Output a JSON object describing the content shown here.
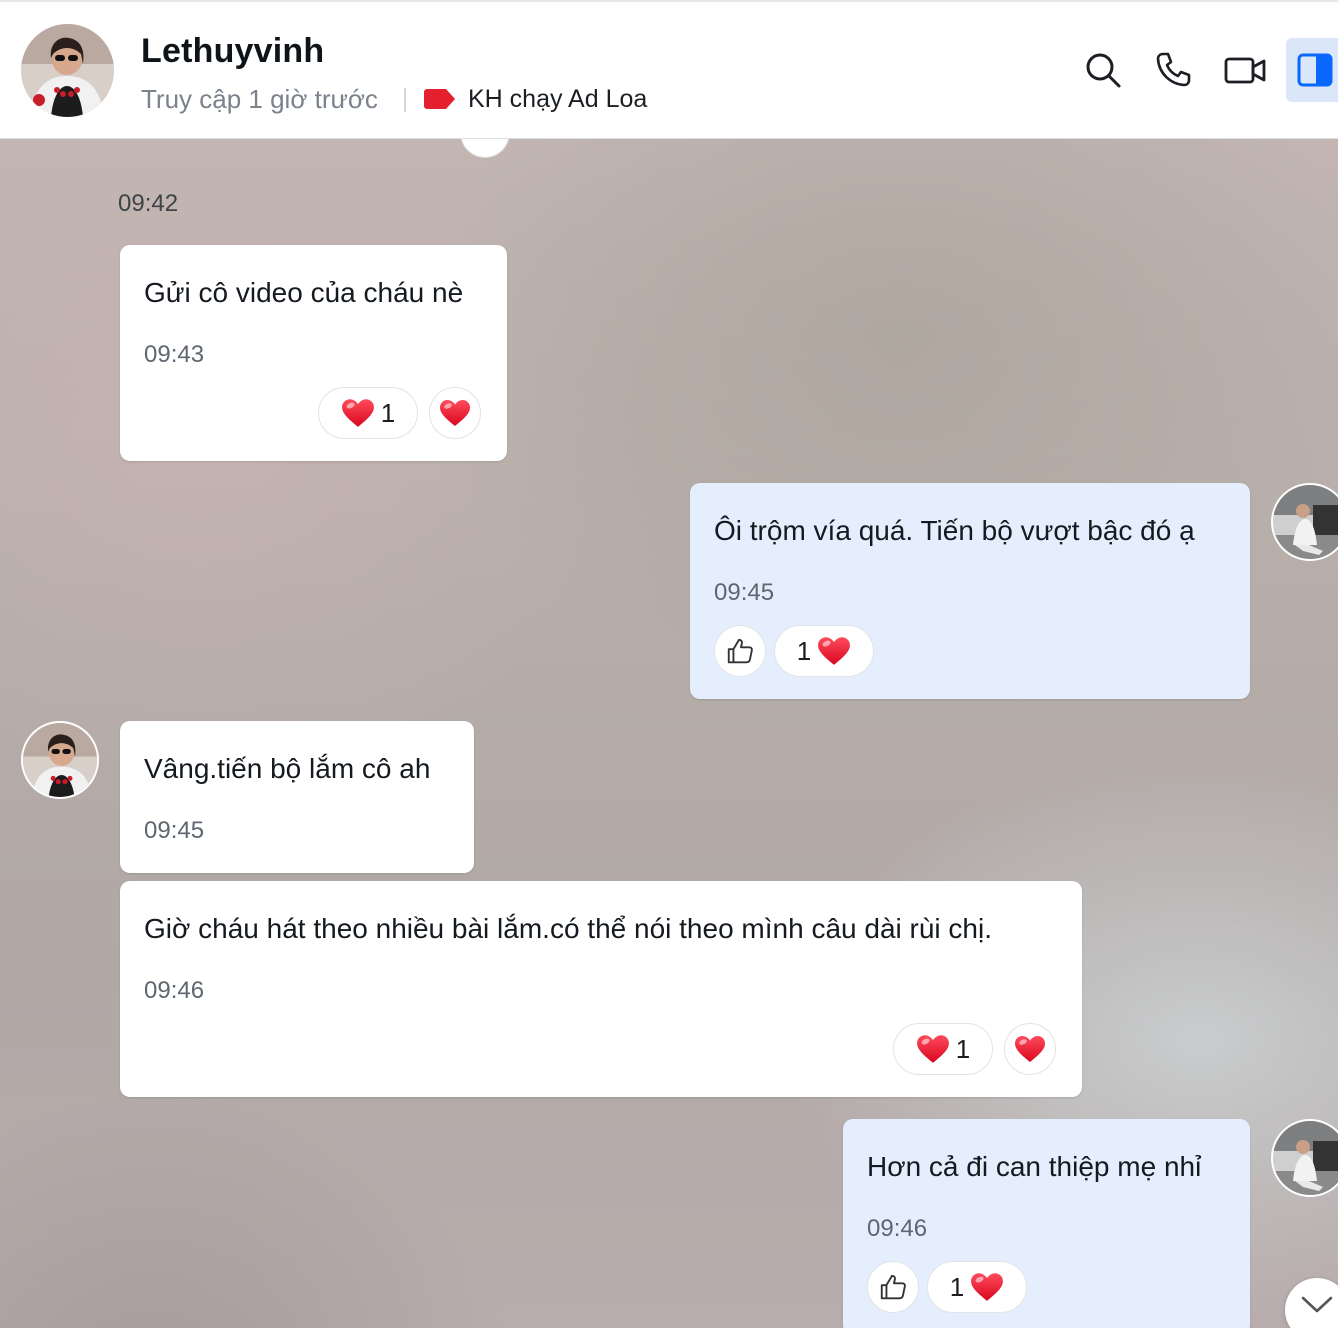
{
  "header": {
    "name": "Lethuyvinh",
    "status": "Truy cập 1 giờ trước",
    "tag_label": "KH chạy Ad Loa",
    "tag_color": "#e5202e",
    "actions": [
      "search-icon",
      "phone-icon",
      "video-call-icon",
      "sidebar-toggle-icon"
    ],
    "accent_color": "#0a68ff"
  },
  "chat": {
    "date_time": "09:42",
    "messages": [
      {
        "id": "m1",
        "sender": "them",
        "text": "Gửi cô video của cháu nè",
        "time": "09:43",
        "reactions": [
          {
            "emoji": "❤️",
            "count": "1"
          },
          {
            "emoji": "❤️",
            "count": ""
          }
        ]
      },
      {
        "id": "m2",
        "sender": "me",
        "text": "Ôi trộm vía quá. Tiến bộ vượt bậc đó ạ",
        "time": "09:45",
        "reactions": [
          {
            "emoji": "like-icon",
            "count": ""
          },
          {
            "emoji": "❤️",
            "count": "1"
          }
        ]
      },
      {
        "id": "m3",
        "sender": "them",
        "text": "Vâng.tiến bộ lắm cô ah",
        "time": "09:45"
      },
      {
        "id": "m4",
        "sender": "them",
        "text": "Giờ cháu hát theo nhiều bài lắm.có thể nói theo mình câu dài rùi chị.",
        "time": "09:46",
        "reactions": [
          {
            "emoji": "❤️",
            "count": "1"
          },
          {
            "emoji": "❤️",
            "count": ""
          }
        ]
      },
      {
        "id": "m5",
        "sender": "me",
        "text": "Hơn cả đi can thiệp mẹ nhỉ",
        "time": "09:46",
        "reactions": [
          {
            "emoji": "like-icon",
            "count": ""
          },
          {
            "emoji": "❤️",
            "count": "1"
          }
        ]
      }
    ]
  }
}
